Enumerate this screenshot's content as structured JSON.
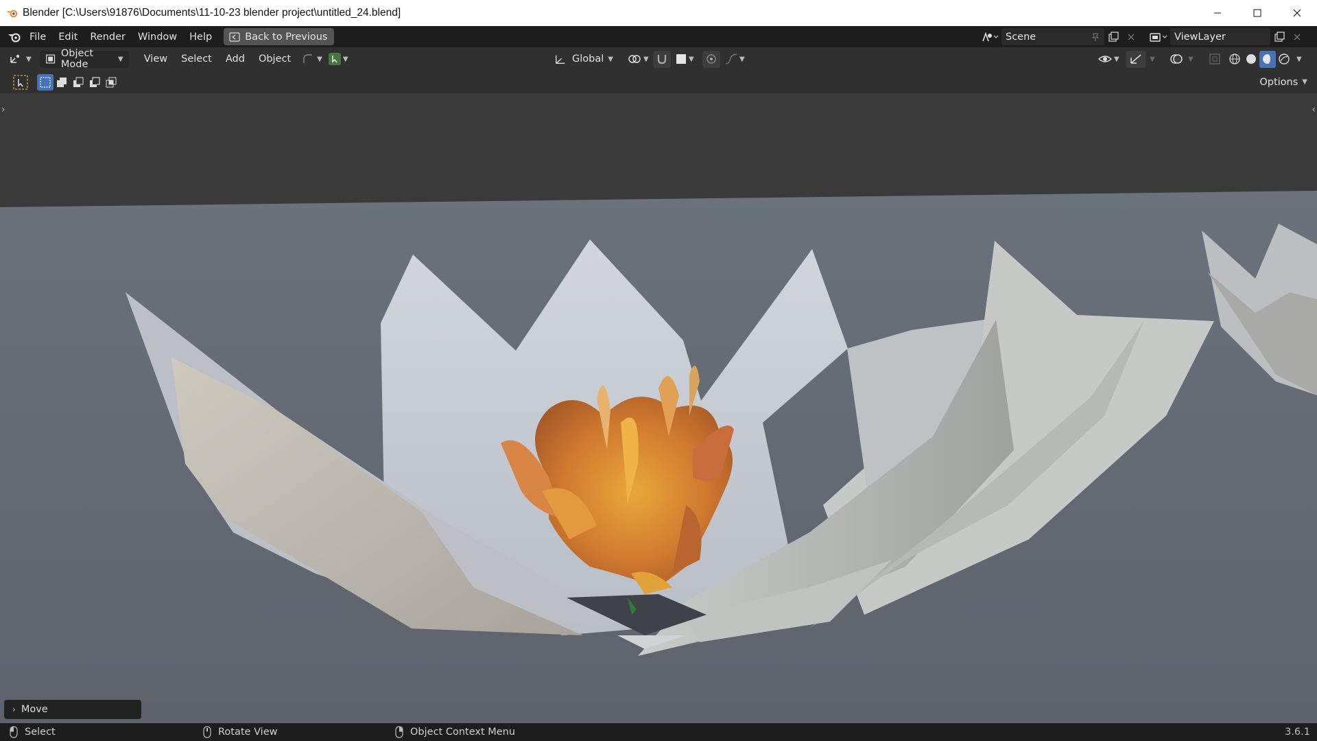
{
  "titlebar": {
    "title": "Blender [C:\\Users\\91876\\Documents\\11-10-23 blender project\\untitled_24.blend]"
  },
  "topbar": {
    "menus": [
      "File",
      "Edit",
      "Render",
      "Window",
      "Help"
    ],
    "back_button": "Back to Previous",
    "scene_name": "Scene",
    "view_layer": "ViewLayer"
  },
  "viewport_header": {
    "mode": "Object Mode",
    "menus": [
      "View",
      "Select",
      "Add",
      "Object"
    ],
    "transform_orientation": "Global"
  },
  "tool_settings": {
    "options_label": "Options"
  },
  "operator_panel": {
    "label": "Move"
  },
  "statusbar": {
    "select": "Select",
    "rotate": "Rotate View",
    "context_menu": "Object Context Menu",
    "version": "3.6.1"
  },
  "colors": {
    "accent": "#4772b3",
    "active_tool": "#477441"
  }
}
